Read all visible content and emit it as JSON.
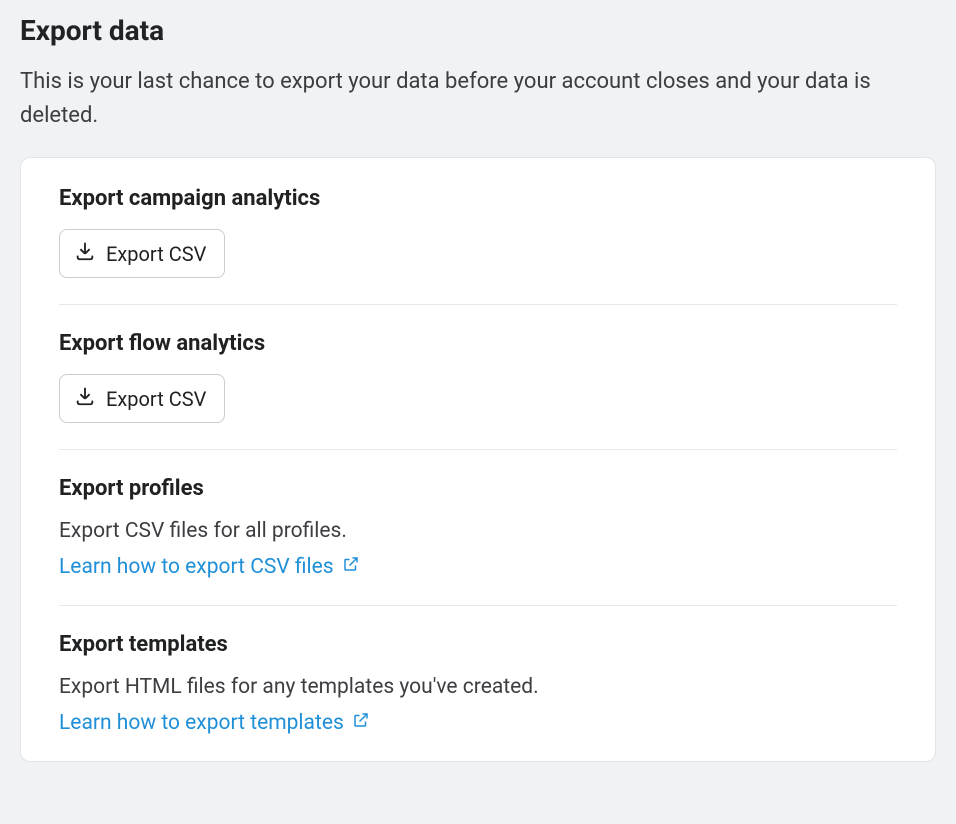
{
  "page": {
    "title": "Export data",
    "subtitle": "This is your last chance to export your data before your account closes and your data is deleted."
  },
  "sections": {
    "campaign": {
      "title": "Export campaign analytics",
      "button": "Export CSV"
    },
    "flow": {
      "title": "Export flow analytics",
      "button": "Export CSV"
    },
    "profiles": {
      "title": "Export profiles",
      "desc": "Export CSV files for all profiles.",
      "link": "Learn how to export CSV files"
    },
    "templates": {
      "title": "Export templates",
      "desc": "Export HTML files for any templates you've created.",
      "link": "Learn how to export templates"
    }
  }
}
